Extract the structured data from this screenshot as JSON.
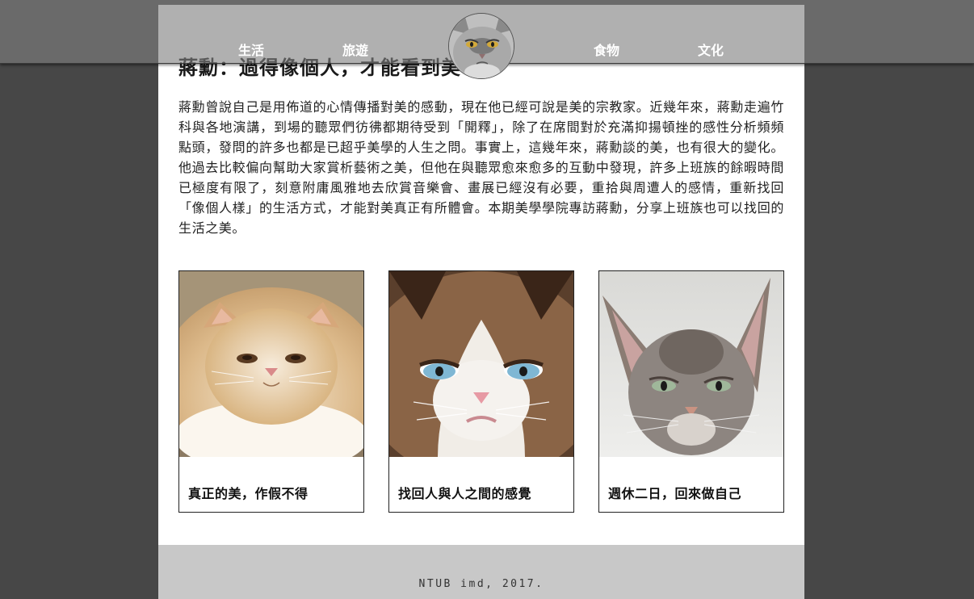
{
  "nav": {
    "items": [
      {
        "label": "生活"
      },
      {
        "label": "旅遊"
      },
      {
        "label": "食物"
      },
      {
        "label": "文化"
      }
    ]
  },
  "article": {
    "title": "蔣勳：過得像個人，才能看到美",
    "intro": "蔣勳曾說自己是用佈道的心情傳播對美的感動，現在他已經可說是美的宗教家。近幾年來，蔣勳走遍竹科與各地演講，到場的聽眾們彷彿都期待受到「開釋」，除了在席間對於充滿抑揚頓挫的感性分析頻頻點頭，發問的許多也都是已超乎美學的人生之問。事實上，這幾年來，蔣勳談的美，也有很大的變化。他過去比較偏向幫助大家賞析藝術之美，但他在與聽眾愈來愈多的互動中發現，許多上班族的餘暇時間已極度有限了，刻意附庸風雅地去欣賞音樂會、畫展已經沒有必要，重拾與周遭人的感情，重新找回「像個人樣」的生活方式，才能對美真正有所體會。本期美學學院專訪蔣勳，分享上班族也可以找回的生活之美。"
  },
  "cards": [
    {
      "caption": "真正的美，作假不得",
      "image": "persian-cat-photo"
    },
    {
      "caption": "找回人與人之間的感覺",
      "image": "grumpy-cat-photo"
    },
    {
      "caption": "週休二日，回來做自己",
      "image": "devon-rex-cat-photo"
    }
  ],
  "footer": {
    "text": "NTUB imd, 2017."
  },
  "colors": {
    "background": "#474747",
    "page": "#ffffff",
    "navbar": "#808080",
    "footer": "#c8c8c8"
  }
}
